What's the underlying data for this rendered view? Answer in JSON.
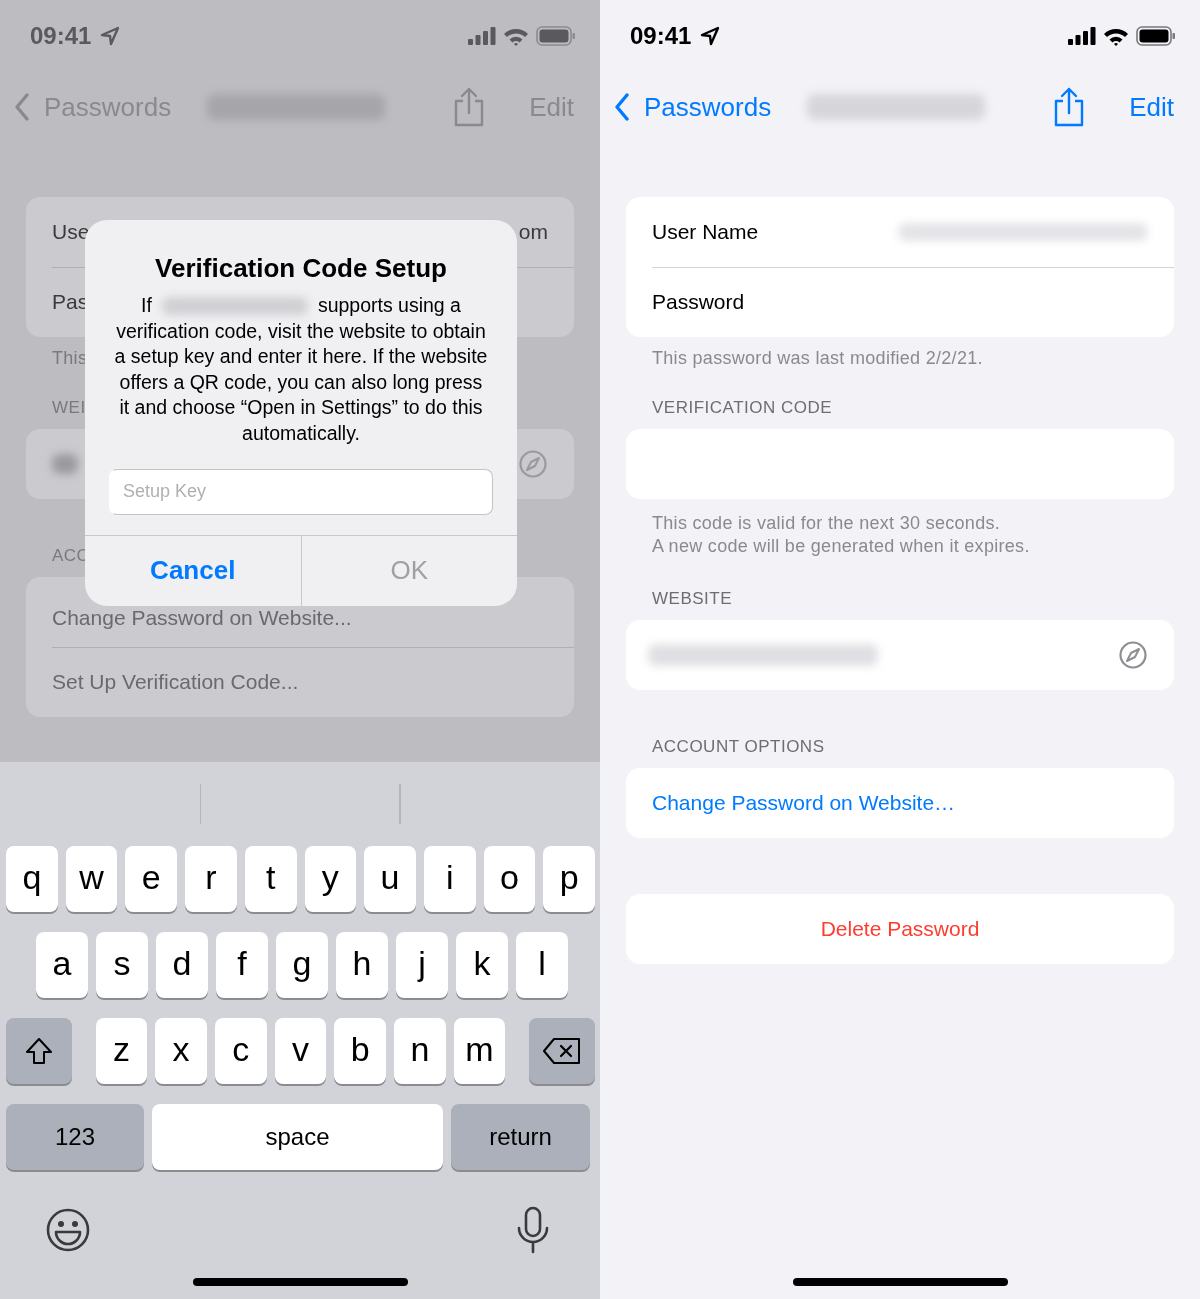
{
  "left": {
    "time": "09:41",
    "back": "Passwords",
    "edit": "Edit",
    "account_rows": [
      {
        "label": "Use",
        "value": "om"
      },
      {
        "label": "Pas",
        "value": ""
      }
    ],
    "footnote": "This",
    "website_header": "WEI",
    "options_header": "ACC",
    "options": [
      "Change Password on Website...",
      "Set Up Verification Code..."
    ],
    "alert": {
      "title": "Verification Code Setup",
      "message_start": "If",
      "message_middle": "supports using a",
      "message_rest": "verification code, visit the website to obtain a setup key and enter it here. If the website offers a QR code, you can also long press it and choose “Open in Settings” to do this automatically.",
      "field": {
        "placeholder": "Setup Key"
      },
      "buttons": [
        {
          "label": "Cancel",
          "kind": "cancel",
          "disabled": false
        },
        {
          "label": "OK",
          "kind": "default",
          "disabled": true
        }
      ]
    },
    "keyboard": {
      "rows": [
        [
          "q",
          "w",
          "e",
          "r",
          "t",
          "y",
          "u",
          "i",
          "o",
          "p"
        ],
        [
          "a",
          "s",
          "d",
          "f",
          "g",
          "h",
          "j",
          "k",
          "l"
        ],
        [
          "z",
          "x",
          "c",
          "v",
          "b",
          "n",
          "m"
        ]
      ],
      "bottom": [
        {
          "label": "123",
          "kind": "mode"
        },
        {
          "label": "space",
          "kind": "space"
        },
        {
          "label": "return",
          "kind": "return"
        }
      ]
    }
  },
  "right": {
    "time": "09:41",
    "back": "Passwords",
    "edit": "Edit",
    "account_rows": [
      {
        "label": "User Name"
      },
      {
        "label": "Password"
      }
    ],
    "modified_note": "This password was last modified 2/2/21.",
    "verification_header": "VERIFICATION CODE",
    "code_note": [
      "This code is valid for the next 30 seconds.",
      "A new code will be generated when it expires."
    ],
    "website_header": "WEBSITE",
    "options_header": "ACCOUNT OPTIONS",
    "options": [
      "Change Password on Website…"
    ],
    "delete": "Delete Password"
  }
}
